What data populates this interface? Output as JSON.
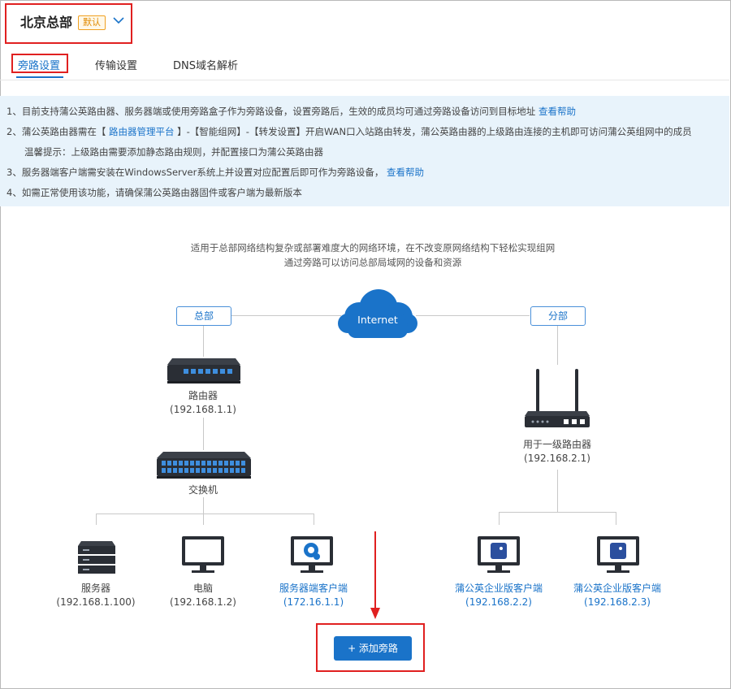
{
  "header": {
    "site_name": "北京总部",
    "default_badge": "默认"
  },
  "tabs": [
    {
      "label": "旁路设置",
      "active": true
    },
    {
      "label": "传输设置",
      "active": false
    },
    {
      "label": "DNS域名解析",
      "active": false
    }
  ],
  "notice": {
    "line1_text": "1、目前支持蒲公英路由器、服务器端或使用旁路盒子作为旁路设备，设置旁路后，生效的成员均可通过旁路设备访问到目标地址",
    "line1_link": "查看帮助",
    "line2_prefix": "2、蒲公英路由器需在【",
    "line2_link": "路由器管理平台",
    "line2_suffix": "】-【智能组网】-【转发设置】开启WAN口入站路由转发，蒲公英路由器的上级路由连接的主机即可访问蒲公英组网中的成员",
    "line2b": "温馨提示：上级路由需要添加静态路由规则，并配置接口为蒲公英路由器",
    "line3_text": "3、服务器端客户端需安装在WindowsServer系统上并设置对应配置后即可作为旁路设备，",
    "line3_link": "查看帮助",
    "line4": "4、如需正常使用该功能，请确保蒲公英路由器固件或客户端为最新版本"
  },
  "diagram": {
    "desc1": "适用于总部网络结构复杂或部署难度大的网络环境，在不改变原网络结构下轻松实现组网",
    "desc2": "通过旁路可以访问总部局域网的设备和资源",
    "hq_tag": "总部",
    "branch_tag": "分部",
    "internet_label": "Internet",
    "hq_router": {
      "name": "路由器",
      "ip": "(192.168.1.1)"
    },
    "switch": {
      "name": "交换机"
    },
    "server": {
      "name": "服务器",
      "ip": "(192.168.1.100)"
    },
    "pc": {
      "name": "电脑",
      "ip": "(192.168.1.2)"
    },
    "server_client": {
      "name": "服务器端客户端",
      "ip": "(172.16.1.1)"
    },
    "branch_router": {
      "name": "用于一级路由器",
      "ip": "(192.168.2.1)"
    },
    "ent_client1": {
      "name": "蒲公英企业版客户端",
      "ip": "(192.168.2.2)"
    },
    "ent_client2": {
      "name": "蒲公英企业版客户端",
      "ip": "(192.168.2.3)"
    }
  },
  "actions": {
    "add_button": "+ 添加旁路"
  },
  "colors": {
    "accent": "#1a73c9",
    "highlight": "#e02020",
    "notice_bg": "#e8f3fb",
    "badge": "#e08a00"
  }
}
